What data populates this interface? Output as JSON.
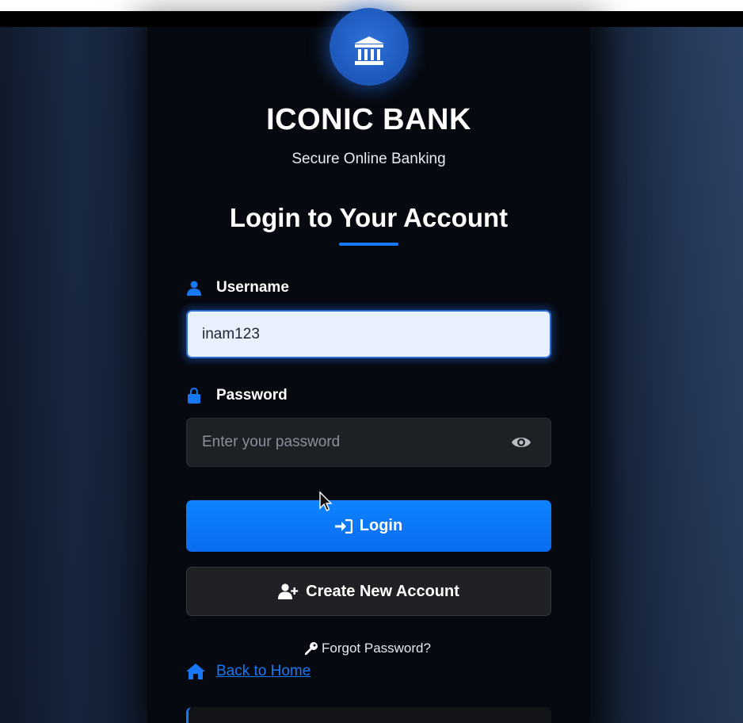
{
  "brand": {
    "name": "ICONIC BANK",
    "tagline": "Secure Online Banking",
    "logo_icon": "bank-icon"
  },
  "form": {
    "heading": "Login to Your Account",
    "username": {
      "label": "Username",
      "icon": "user-icon",
      "value": "inam123"
    },
    "password": {
      "label": "Password",
      "icon": "lock-icon",
      "placeholder": "Enter your password",
      "toggle_icon": "eye-icon"
    },
    "login_button": {
      "label": "Login",
      "icon": "sign-in-icon"
    },
    "create_button": {
      "label": "Create New Account",
      "icon": "user-plus-icon"
    },
    "forgot_link": {
      "label": "Forgot Password?",
      "icon": "key-icon"
    },
    "back_link": {
      "label": "Back to Home",
      "icon": "home-icon"
    }
  },
  "colors": {
    "accent": "#1877f2",
    "card_bg": "#06090f",
    "input_active_bg": "#e8f0fd",
    "input_bg": "#1d2025",
    "secondary_button_bg": "#1f2125"
  }
}
